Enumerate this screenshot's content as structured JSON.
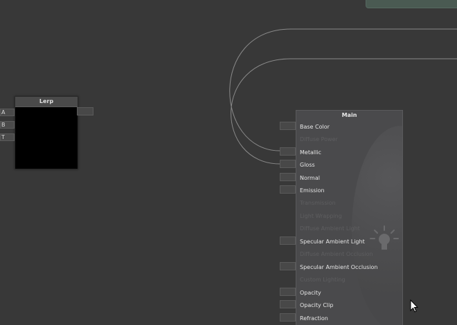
{
  "lerp_node": {
    "title": "Lerp",
    "inputs": [
      "A",
      "B",
      "T"
    ]
  },
  "main_node": {
    "title": "Main",
    "rows": [
      {
        "label": "Base Color",
        "enabled": true,
        "connected": false
      },
      {
        "label": "Diffuse Power",
        "enabled": false,
        "connected": false
      },
      {
        "label": "Metallic",
        "enabled": true,
        "connected": true
      },
      {
        "label": "Gloss",
        "enabled": true,
        "connected": true
      },
      {
        "label": "Normal",
        "enabled": true,
        "connected": false
      },
      {
        "label": "Emission",
        "enabled": true,
        "connected": false
      },
      {
        "label": "Transmission",
        "enabled": false,
        "connected": false
      },
      {
        "label": "Light Wrapping",
        "enabled": false,
        "connected": false
      },
      {
        "label": "Diffuse Ambient Light",
        "enabled": false,
        "connected": false
      },
      {
        "label": "Specular Ambient Light",
        "enabled": true,
        "connected": false
      },
      {
        "label": "Diffuse Ambient Occlusion",
        "enabled": false,
        "connected": false
      },
      {
        "label": "Specular Ambient Occlusion",
        "enabled": true,
        "connected": false
      },
      {
        "label": "Custom Lighting",
        "enabled": false,
        "connected": false
      },
      {
        "label": "Opacity",
        "enabled": true,
        "connected": false
      },
      {
        "label": "Opacity Clip",
        "enabled": true,
        "connected": false
      },
      {
        "label": "Refraction",
        "enabled": true,
        "connected": false
      }
    ]
  },
  "icons": {
    "lightbulb": "lightbulb-icon",
    "cursor": "mouse-cursor-icon"
  },
  "colors": {
    "canvas": "#383838",
    "wire": "#8a8a8a",
    "node_body": "#4a4a4c",
    "label_enabled": "#e6e6e6",
    "label_disabled": "#5e5e60"
  }
}
